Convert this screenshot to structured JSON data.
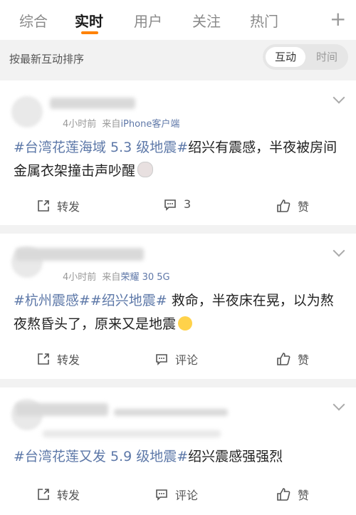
{
  "tabs": [
    {
      "label": "综合",
      "active": false
    },
    {
      "label": "实时",
      "active": true
    },
    {
      "label": "用户",
      "active": false
    },
    {
      "label": "关注",
      "active": false
    },
    {
      "label": "热门",
      "active": false
    }
  ],
  "sortbar": {
    "label": "按最新互动排序",
    "toggle_active": "互动",
    "toggle_other": "时间"
  },
  "posts": [
    {
      "time": "4小时前",
      "from_prefix": "来自",
      "source": "iPhone客户端",
      "topic": "#台湾花莲海域 5.3 级地震#",
      "text": "绍兴有震感，半夜被房间金属衣架撞击声吵醒",
      "actions": {
        "repost": "转发",
        "comment": "3",
        "like": "赞"
      }
    },
    {
      "time": "4小时前",
      "from_prefix": "来自",
      "source": "荣耀 30 5G",
      "topic": "#杭州震感##绍兴地震#",
      "text": " 救命，半夜床在晃，以为熬夜熬昏头了，原来又是地震",
      "actions": {
        "repost": "转发",
        "comment": "评论",
        "like": "赞"
      }
    },
    {
      "topic": "#台湾花莲又发 5.9 级地震#",
      "text": "绍兴震感强强烈",
      "actions": {
        "repost": "转发",
        "comment": "评论",
        "like": "赞"
      }
    }
  ],
  "colors": {
    "accent": "#ff8200",
    "link": "#5d78a8"
  }
}
